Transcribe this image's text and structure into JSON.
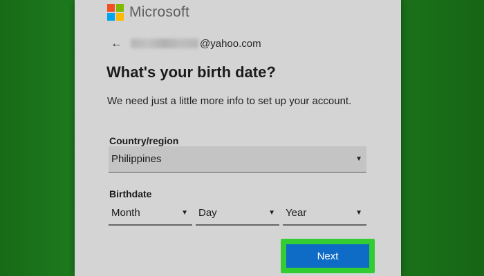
{
  "brand": {
    "name": "Microsoft",
    "logo_colors": [
      "#f25022",
      "#7fba00",
      "#00a4ef",
      "#ffb900"
    ]
  },
  "account": {
    "email_domain": "@yahoo.com",
    "back_icon": "arrow-left-icon"
  },
  "heading": "What's your birth date?",
  "description": "We need just a little more info to set up your account.",
  "country": {
    "label": "Country/region",
    "value": "Philippines"
  },
  "birthdate": {
    "label": "Birthdate",
    "month_placeholder": "Month",
    "day_placeholder": "Day",
    "year_placeholder": "Year"
  },
  "next_label": "Next",
  "colors": {
    "accent": "#0f6cc6",
    "highlight": "#33cc33",
    "background": "#1a6b1a"
  }
}
